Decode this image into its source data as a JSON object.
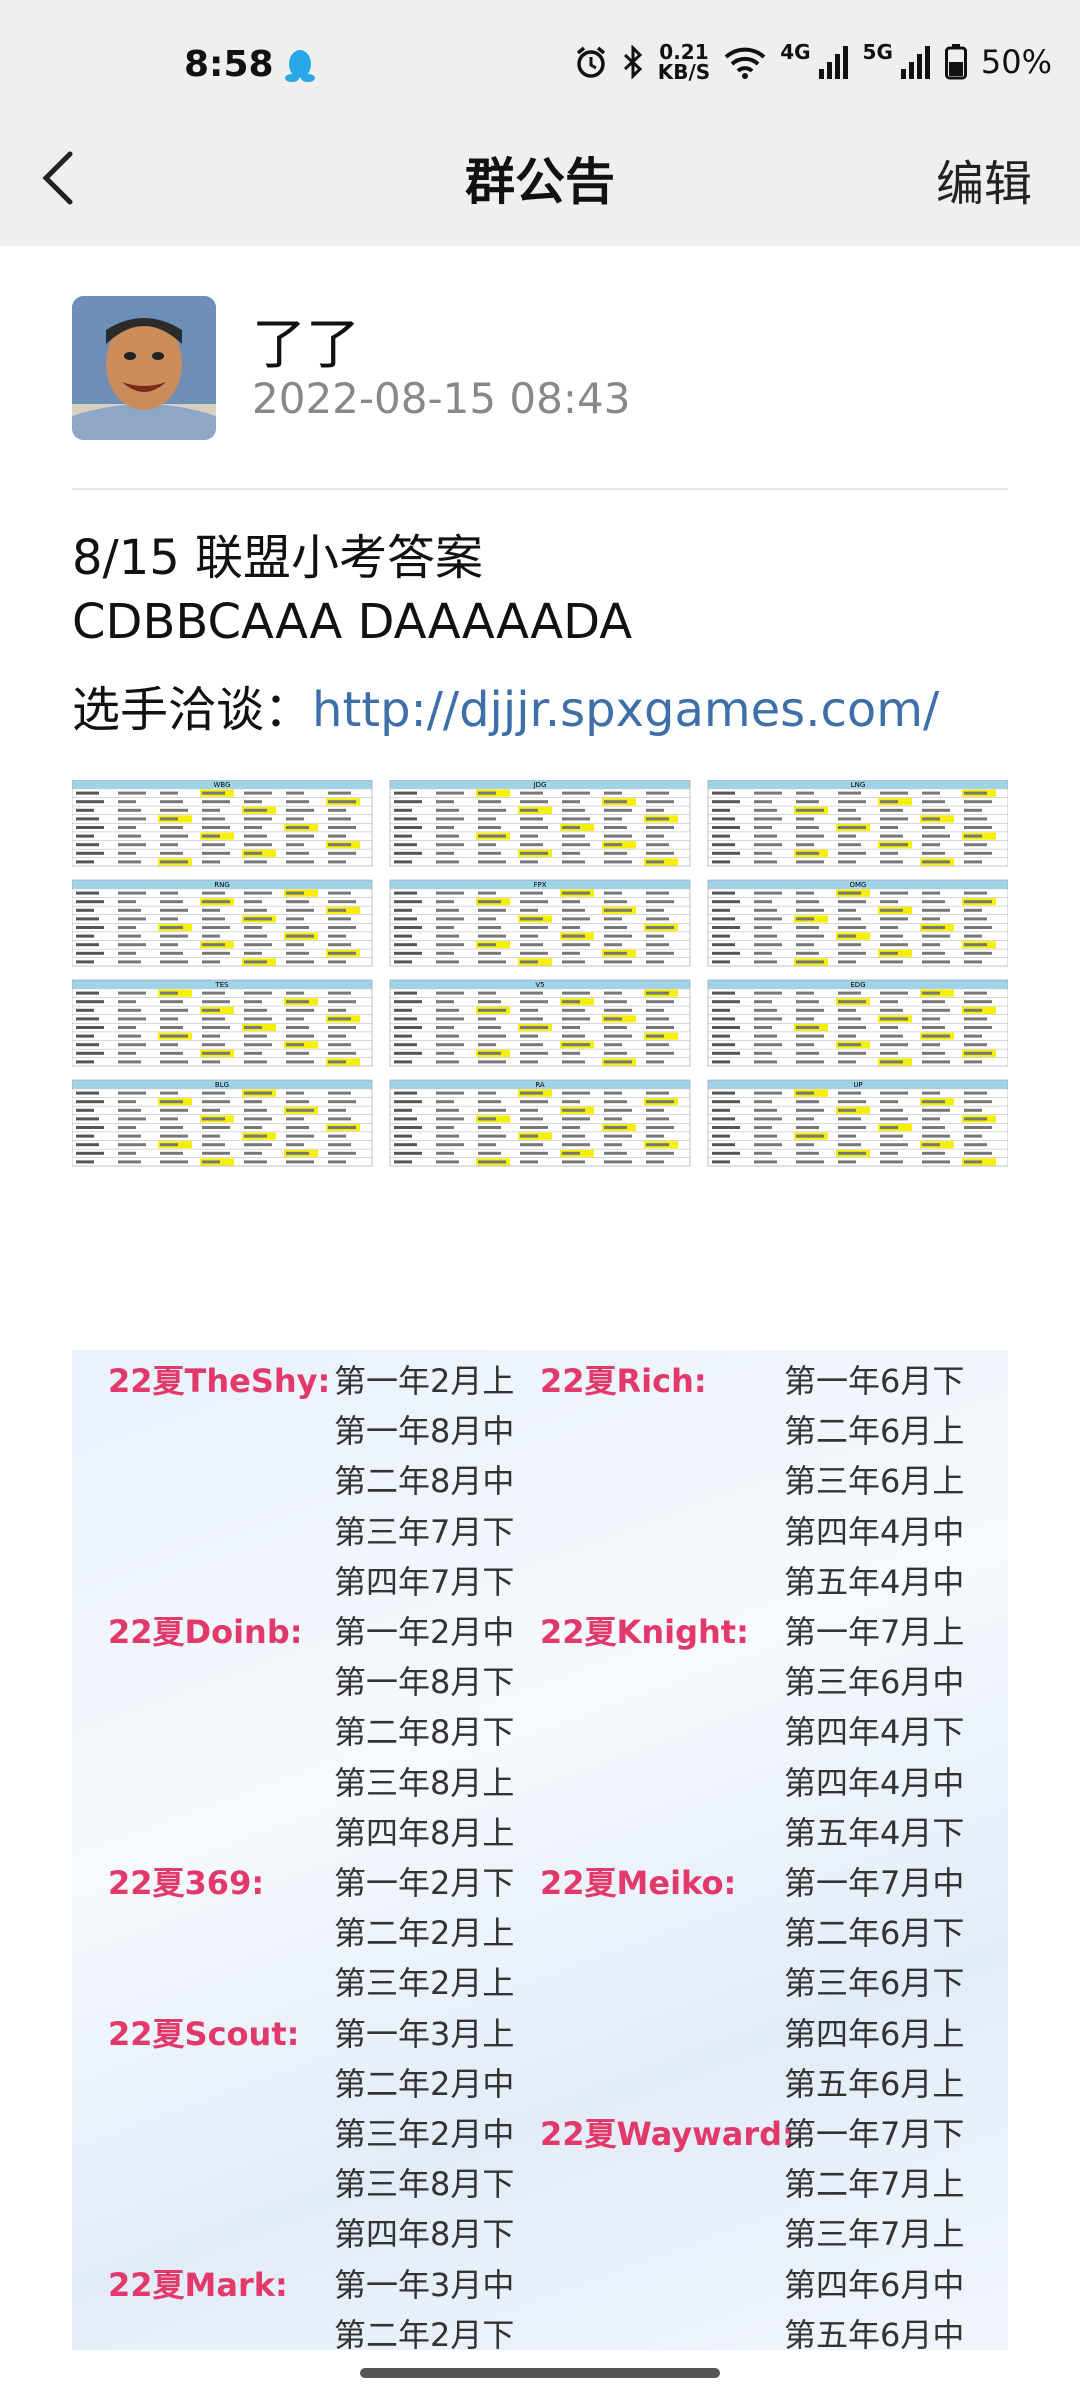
{
  "status_bar": {
    "time": "8:58",
    "net_speed_value": "0.21",
    "net_speed_unit": "KB/S",
    "signal1": "4G",
    "signal2": "5G",
    "battery": "50%"
  },
  "header": {
    "title": "群公告",
    "edit": "编辑"
  },
  "post": {
    "author": "了了",
    "date": "2022-08-15 08:43",
    "line1": "8/15 联盟小考答案",
    "line2": "CDBBCAAA DAAAAADA",
    "line3_prefix": "选手洽谈：",
    "line3_link": "http://djjjr.spxgames.com/"
  },
  "table_image": {
    "teams": [
      "WBG",
      "JDG",
      "LNG",
      "RNG",
      "FPX",
      "OMG",
      "TES",
      "V5",
      "EDG",
      "BLG",
      "RA",
      "UP"
    ],
    "players": [
      "Wayward",
      "Knight",
      "Rich",
      "Meiko",
      "TheShy",
      "369",
      "Doinb",
      "Scout",
      "Mark",
      "Flandre",
      "Clearlove",
      "Zoom"
    ]
  },
  "calendar": {
    "left": [
      {
        "name": "22夏TheShy:",
        "items": [
          "第一年2月上",
          "第一年8月中",
          "第二年8月中",
          "第三年7月下",
          "第四年7月下"
        ]
      },
      {
        "name": "22夏Doinb:",
        "items": [
          "第一年2月中",
          "第一年8月下",
          "第二年8月下",
          "第三年8月上",
          "第四年8月上"
        ]
      },
      {
        "name": "22夏369:",
        "items": [
          "第一年2月下",
          "第二年2月上",
          "第三年2月上"
        ]
      },
      {
        "name": "22夏Scout:",
        "items": [
          "第一年3月上",
          "第二年2月中",
          "第三年2月中",
          "第三年8月下",
          "第四年8月下"
        ]
      },
      {
        "name": "22夏Mark:",
        "items": [
          "第一年3月中",
          "第二年2月下"
        ]
      }
    ],
    "right": [
      {
        "name": "22夏Rich:",
        "items": [
          "第一年6月下",
          "第二年6月上",
          "第三年6月上",
          "第四年4月中",
          "第五年4月中"
        ]
      },
      {
        "name": "22夏Knight:",
        "items": [
          "第一年7月上",
          "第三年6月中",
          "第四年4月下",
          "第四年4月中",
          "第五年4月下"
        ]
      },
      {
        "name": "22夏Meiko:",
        "items": [
          "第一年7月中",
          "第二年6月下",
          "第三年6月下",
          "第四年6月上",
          "第五年6月上"
        ]
      },
      {
        "name": "22夏Wayward:",
        "items": [
          "第一年7月下",
          "第二年7月上",
          "第三年7月上",
          "第四年6月中",
          "第五年6月中"
        ]
      }
    ]
  }
}
